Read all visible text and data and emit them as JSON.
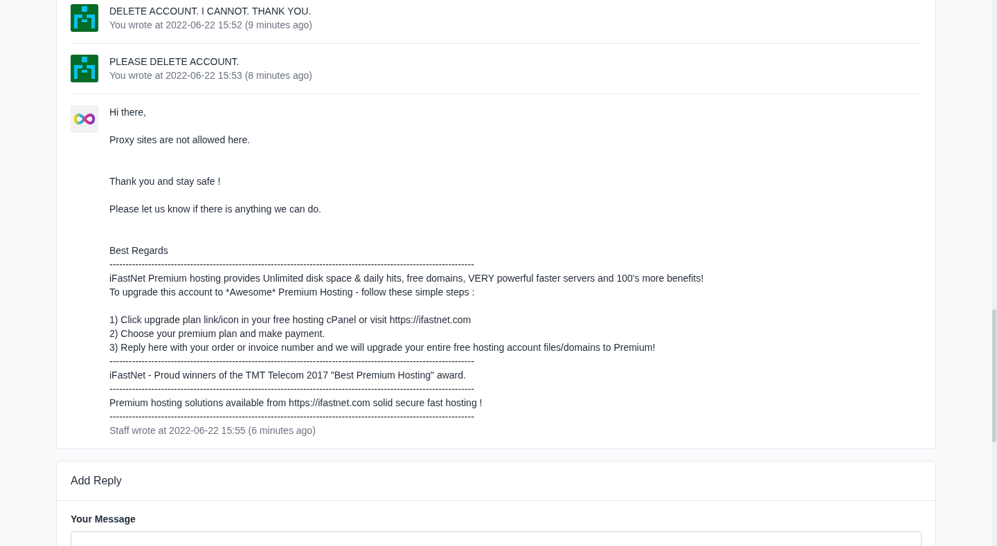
{
  "messages": [
    {
      "kind": "user",
      "lines": [
        "DELETE ACCOUNT. I CANNOT. THANK YOU."
      ],
      "meta": "You wrote at 2022-06-22 15:52 (9 minutes ago)"
    },
    {
      "kind": "user",
      "lines": [
        "PLEASE DELETE ACCOUNT."
      ],
      "meta": "You wrote at 2022-06-22 15:53 (8 minutes ago)"
    },
    {
      "kind": "staff",
      "paragraphs": [
        {
          "kind": "first",
          "lines": [
            "Hi there,"
          ]
        },
        {
          "kind": "para",
          "lines": [
            "Proxy sites are not allowed here."
          ]
        },
        {
          "kind": "section",
          "lines": [
            "Thank you and stay safe !"
          ]
        },
        {
          "kind": "para",
          "lines": [
            "Please let us know if there is anything we can do."
          ]
        },
        {
          "kind": "section",
          "lines": [
            "Best Regards",
            "-----------------------------------------------------------------------------------------------------------------",
            "iFastNet Premium hosting provides Unlimited disk space & daily hits, free domains, VERY powerful faster servers and 100's more benefits!",
            "To upgrade this account to *Awesome* Premium Hosting - follow these simple steps :"
          ]
        },
        {
          "kind": "para",
          "lines": [
            "1) Click upgrade plan link/icon in your free hosting cPanel or visit https://ifastnet.com",
            "2) Choose your premium plan and make payment.",
            "3) Reply here with your order or invoice number and we will upgrade your entire free hosting account files/domains to Premium!",
            "-----------------------------------------------------------------------------------------------------------------",
            "iFastNet - Proud winners of the TMT Telecom 2017 \"Best Premium Hosting\" award.",
            "-----------------------------------------------------------------------------------------------------------------",
            "Premium hosting solutions available from https://ifastnet.com solid secure fast hosting !",
            "-----------------------------------------------------------------------------------------------------------------"
          ]
        }
      ],
      "meta": "Staff wrote at 2022-06-22 15:55 (6 minutes ago)"
    }
  ],
  "reply": {
    "title": "Add Reply",
    "label": "Your Message"
  }
}
